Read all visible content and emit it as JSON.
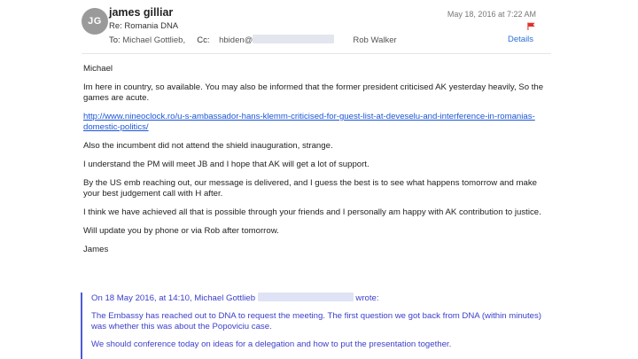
{
  "header": {
    "avatar_initials": "JG",
    "sender_name": "james gilliar",
    "subject": "Re: Romania DNA",
    "to_label": "To:",
    "to_value": "Michael Gottlieb,",
    "cc_label": "Cc:",
    "cc_value": "hbiden@",
    "cc_other": "Rob Walker",
    "date": "May 18, 2016 at 7:22 AM",
    "details_label": "Details",
    "flag_color": "#e0302a"
  },
  "body": {
    "greeting": "Michael",
    "p1": "Im here in country, so available. You may also be informed that the former president criticised AK yesterday heavily, So the games are acute.",
    "link": "http://www.nineoclock.ro/u-s-ambassador-hans-klemm-criticised-for-guest-list-at-deveselu-and-interference-in-romanias-domestic-politics/",
    "p2": "Also the incumbent did not attend the shield inauguration, strange.",
    "p3": "I understand the PM will meet JB and I hope that AK will get a lot of support.",
    "p4": "By the US emb reaching out, our message is delivered, and I guess the best is to see what happens tomorrow and make your best judgement call with H after.",
    "p5": "I think we have achieved all that is possible through your friends and I personally am happy with AK contribution to justice.",
    "p6": "Will update you by phone or via Rob after tomorrow.",
    "signature": "James"
  },
  "quote": {
    "intro_prefix": "On 18 May 2016, at 14:10, Michael Gottlieb",
    "intro_suffix": "wrote:",
    "q1": "The Embassy has reached out to DNA to request the meeting. The first question we got back from DNA (within minutes) was whether this was about the Popoviciu case.",
    "q2": "We should conference today on ideas for a delegation and how to put the presentation together."
  }
}
